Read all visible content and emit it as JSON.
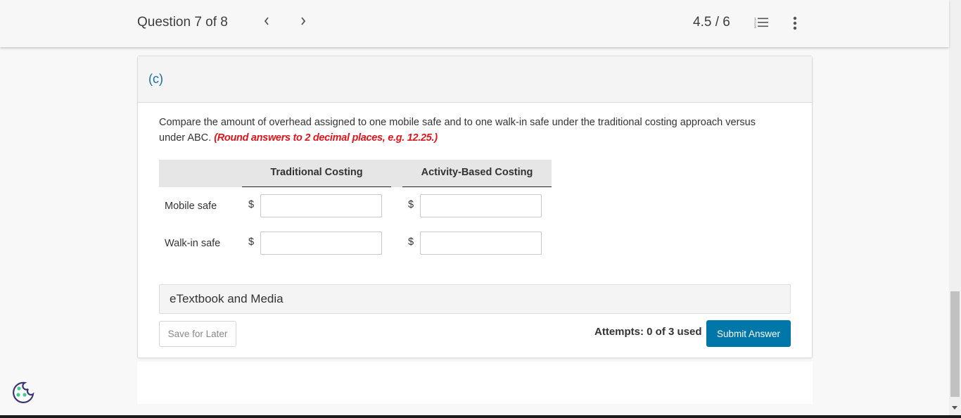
{
  "header": {
    "question_label": "Question 7 of 8",
    "prev_icon": "‹",
    "next_icon": "›",
    "score": "4.5 / 6",
    "icons": [
      "numbered-list-icon",
      "more-vertical-icon"
    ]
  },
  "question": {
    "part": "(c)",
    "text": "Compare the amount of overhead assigned to one mobile safe and to one walk-in safe under the traditional costing approach versus under ABC.",
    "hint": "(Round answers to 2 decimal places, e.g. 12.25.)"
  },
  "table": {
    "columns": [
      "Traditional Costing",
      "Activity-Based Costing"
    ],
    "currency_symbol": "$",
    "rows": [
      {
        "label": "Mobile safe",
        "traditional": "",
        "abc": ""
      },
      {
        "label": "Walk-in safe",
        "traditional": "",
        "abc": ""
      }
    ]
  },
  "etextbook_label": "eTextbook and Media",
  "footer": {
    "save_label": "Save for Later",
    "attempts": "Attempts: 0 of 3 used",
    "submit_label": "Submit Answer"
  },
  "colors": {
    "accent": "#0077a8",
    "part_label": "#1a6fa6",
    "hint": "#e0151b",
    "cookie_outline": "#3a3577",
    "cookie_dots": "#3ecf8e"
  }
}
